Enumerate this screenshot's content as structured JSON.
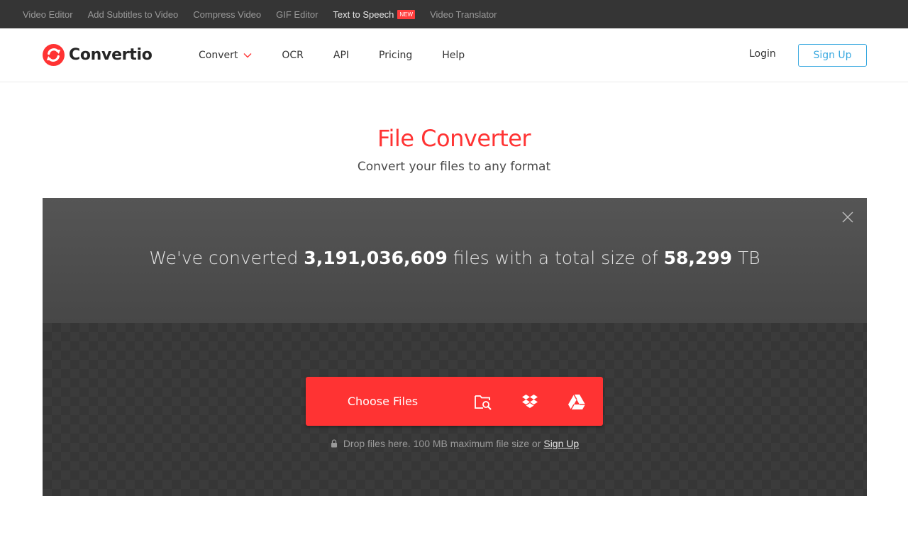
{
  "topbar": {
    "links": [
      {
        "label": "Video Editor"
      },
      {
        "label": "Add Subtitles to Video"
      },
      {
        "label": "Compress Video"
      },
      {
        "label": "GIF Editor"
      },
      {
        "label": "Text to Speech",
        "badge": "NEW"
      },
      {
        "label": "Video Translator"
      }
    ]
  },
  "header": {
    "logo_text": "Convertio",
    "nav": {
      "convert": "Convert",
      "ocr": "OCR",
      "api": "API",
      "pricing": "Pricing",
      "help": "Help"
    },
    "login": "Login",
    "signup": "Sign Up"
  },
  "hero": {
    "title": "File Converter",
    "subtitle": "Convert your files to any format"
  },
  "stats": {
    "prefix": "We've converted",
    "files_count": "3,191,036,609",
    "middle": "files with a total size of",
    "total_size": "58,299",
    "unit": "TB"
  },
  "upload": {
    "choose_label": "Choose Files",
    "icons": [
      "folder-search-icon",
      "dropbox-icon",
      "google-drive-icon"
    ],
    "hint_text": "Drop files here. 100 MB maximum file size or",
    "hint_link": "Sign Up"
  },
  "colors": {
    "brand_red": "#ff3333",
    "signup_blue": "#3aa9e0",
    "topbar_bg": "#353535"
  }
}
